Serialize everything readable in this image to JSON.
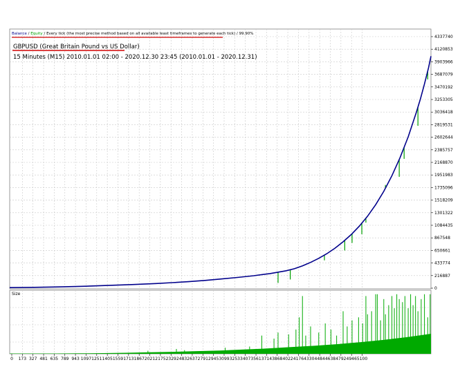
{
  "chart_data": {
    "type": "line",
    "header": {
      "balance": "Balance",
      "separator1": " / ",
      "equity": "Equity",
      "separator2": " / ",
      "rest": "Every tick (the most precise method based on all available least timeframes to generate each tick)",
      "separator3": " / ",
      "quality": "99.90%"
    },
    "title": "GBPUSD (Great Britain Pound vs US Dollar)",
    "subtitle": "15 Minutes (M15) 2010.01.01 02:00 - 2020.12.30 23:45 (2010.01.01 - 2020.12.31)",
    "size_label": "Size",
    "y_ticks": [
      "4337740",
      "4120853",
      "3903966",
      "3687079",
      "3470192",
      "3253305",
      "3036418",
      "2819531",
      "2602644",
      "2385757",
      "2168870",
      "1951983",
      "1735096",
      "1518209",
      "1301322",
      "1084435",
      "867548",
      "650661",
      "433774",
      "216887",
      "0"
    ],
    "x_ticks": [
      "0",
      "173",
      "327",
      "481",
      "635",
      "789",
      "943",
      "1097",
      "1251",
      "1405",
      "1559",
      "1713",
      "1867",
      "2021",
      "2175",
      "2329",
      "2483",
      "2637",
      "2791",
      "2945",
      "3099",
      "3253",
      "3407",
      "3561",
      "3714",
      "3868",
      "4022",
      "4176",
      "4330",
      "4484",
      "4638",
      "4792",
      "4946",
      "5100"
    ],
    "ylim": [
      0,
      4337740
    ],
    "xlim": [
      0,
      5180
    ],
    "series": [
      {
        "name": "Balance",
        "color": "#00008b",
        "x": [
          0,
          300,
          600,
          900,
          1200,
          1500,
          1800,
          2000,
          2200,
          2400,
          2600,
          2800,
          3000,
          3200,
          3400,
          3500,
          3600,
          3700,
          3800,
          3900,
          4000,
          4100,
          4200,
          4300,
          4400,
          4500,
          4600,
          4700,
          4800,
          4900,
          5000,
          5050,
          5100,
          5150,
          5180
        ],
        "values": [
          10000,
          14000,
          21000,
          32000,
          46000,
          62000,
          80000,
          95000,
          112000,
          133000,
          158000,
          185000,
          215000,
          252000,
          300000,
          335000,
          385000,
          445000,
          515000,
          595000,
          690000,
          800000,
          925000,
          1070000,
          1240000,
          1440000,
          1670000,
          1940000,
          2250000,
          2610000,
          3030000,
          3260000,
          3520000,
          3800000,
          4000000
        ]
      },
      {
        "name": "Equity",
        "color": "#00a000",
        "drawdowns": [
          {
            "x": 3300,
            "low": 90000
          },
          {
            "x": 3450,
            "low": 150000
          },
          {
            "x": 3870,
            "low": 480000
          },
          {
            "x": 4120,
            "low": 650000
          },
          {
            "x": 4210,
            "low": 780000
          },
          {
            "x": 4330,
            "low": 930000
          },
          {
            "x": 4380,
            "low": 1130000
          },
          {
            "x": 4620,
            "low": 1780000
          },
          {
            "x": 4700,
            "low": 1950000
          },
          {
            "x": 4790,
            "low": 1920000
          },
          {
            "x": 4850,
            "low": 2230000
          },
          {
            "x": 5020,
            "low": 2800000
          },
          {
            "x": 5140,
            "low": 3600000
          }
        ]
      }
    ],
    "size_series": {
      "name": "Size",
      "color": "#00aa00",
      "baseline": [
        0.01,
        0.01,
        0.01,
        0.015,
        0.02,
        0.03,
        0.045,
        0.06,
        0.08,
        0.1,
        0.13,
        0.16,
        0.2,
        0.24,
        0.29,
        0.35,
        0.42,
        0.5,
        0.6
      ],
      "spikes": [
        {
          "x": 1700,
          "v": 0.05
        },
        {
          "x": 2050,
          "v": 0.08
        },
        {
          "x": 2150,
          "v": 0.06
        },
        {
          "x": 2650,
          "v": 0.1
        },
        {
          "x": 2950,
          "v": 0.12
        },
        {
          "x": 3100,
          "v": 0.3
        },
        {
          "x": 3250,
          "v": 0.25
        },
        {
          "x": 3300,
          "v": 0.35
        },
        {
          "x": 3430,
          "v": 0.32
        },
        {
          "x": 3520,
          "v": 0.4
        },
        {
          "x": 3560,
          "v": 0.6
        },
        {
          "x": 3600,
          "v": 0.95
        },
        {
          "x": 3640,
          "v": 0.3
        },
        {
          "x": 3700,
          "v": 0.45
        },
        {
          "x": 3800,
          "v": 0.35
        },
        {
          "x": 3880,
          "v": 0.5
        },
        {
          "x": 3950,
          "v": 0.4
        },
        {
          "x": 4020,
          "v": 0.3
        },
        {
          "x": 4100,
          "v": 0.7
        },
        {
          "x": 4150,
          "v": 0.45
        },
        {
          "x": 4210,
          "v": 0.55
        },
        {
          "x": 4290,
          "v": 0.6
        },
        {
          "x": 4340,
          "v": 0.5
        },
        {
          "x": 4380,
          "v": 0.95
        },
        {
          "x": 4400,
          "v": 0.65
        },
        {
          "x": 4450,
          "v": 0.7
        },
        {
          "x": 4500,
          "v": 0.98
        },
        {
          "x": 4520,
          "v": 0.98
        },
        {
          "x": 4560,
          "v": 0.55
        },
        {
          "x": 4600,
          "v": 0.9
        },
        {
          "x": 4620,
          "v": 0.65
        },
        {
          "x": 4660,
          "v": 0.8
        },
        {
          "x": 4700,
          "v": 0.95
        },
        {
          "x": 4730,
          "v": 0.75
        },
        {
          "x": 4760,
          "v": 0.98
        },
        {
          "x": 4790,
          "v": 0.9
        },
        {
          "x": 4830,
          "v": 0.85
        },
        {
          "x": 4860,
          "v": 0.95
        },
        {
          "x": 4900,
          "v": 0.75
        },
        {
          "x": 4930,
          "v": 0.98
        },
        {
          "x": 4960,
          "v": 0.8
        },
        {
          "x": 4990,
          "v": 0.95
        },
        {
          "x": 5020,
          "v": 0.7
        },
        {
          "x": 5060,
          "v": 0.9
        },
        {
          "x": 5100,
          "v": 0.98
        },
        {
          "x": 5140,
          "v": 0.6
        },
        {
          "x": 5170,
          "v": 0.98
        }
      ]
    },
    "grid": true,
    "colors": {
      "balance": "#00008b",
      "equity": "#00a000",
      "size": "#00aa00",
      "grid": "#c8c8c8",
      "title_underline": "#d00000"
    }
  }
}
